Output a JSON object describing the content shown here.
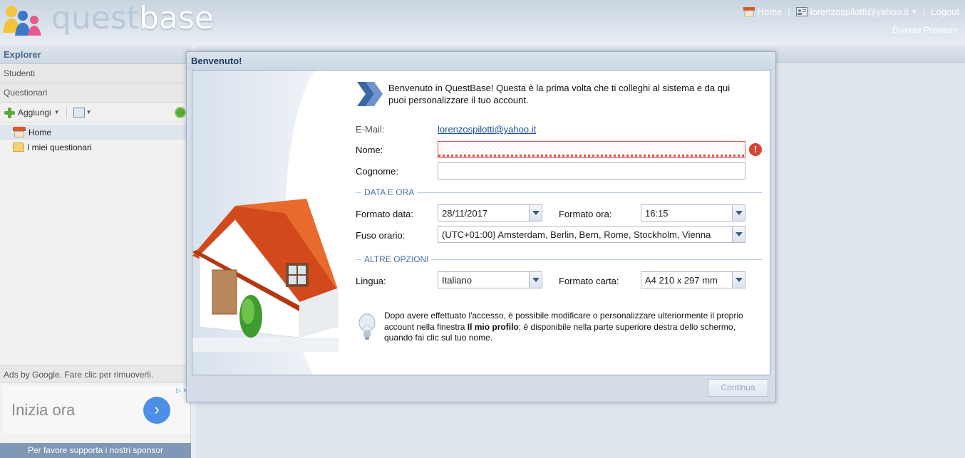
{
  "header": {
    "logo_text_left": "quest",
    "logo_text_right": "base",
    "home_label": "Home",
    "user_label": "lorenzospilotti@yahoo.it",
    "logout_label": "Logout",
    "premium_label": "Diventa Premium",
    "separator": "|"
  },
  "sidebar": {
    "title": "Explorer",
    "items": [
      {
        "label": "Studenti"
      },
      {
        "label": "Questionari"
      }
    ],
    "toolbar": {
      "add_label": "Aggiungi"
    },
    "tree": [
      {
        "label": "Home",
        "icon": "home-icon"
      },
      {
        "label": "I miei questionari",
        "icon": "folder-icon"
      }
    ],
    "ads_label": "Ads by Google. Fare clic per rimuoverli.",
    "ad": {
      "text": "Inizia ora",
      "button": "›"
    },
    "sponsor_label": "Per favore supporta i nostri sponsor"
  },
  "dialog": {
    "title": "Benvenuto!",
    "welcome_text": "Benvenuto in QuestBase! Questa è la prima volta che ti colleghi al sistema e da qui puoi personalizzare il tuo account.",
    "email_label": "E-Mail:",
    "email_value": "lorenzospilotti@yahoo.it",
    "nome_label": "Nome:",
    "nome_value": "",
    "cognome_label": "Cognome:",
    "cognome_value": "",
    "section_date": "DATA E ORA",
    "date_format_label": "Formato data:",
    "date_format_value": "28/11/2017",
    "time_format_label": "Formato ora:",
    "time_format_value": "16:15",
    "timezone_label": "Fuso orario:",
    "timezone_value": "(UTC+01:00) Amsterdam, Berlin, Bern, Rome, Stockholm, Vienna",
    "section_other": "ALTRE OPZIONI",
    "language_label": "Lingua:",
    "language_value": "Italiano",
    "paper_label": "Formato carta:",
    "paper_value": "A4 210 x 297 mm",
    "tip_part1": "Dopo avere effettuato l'accesso, è possibile modificare o personalizzare ulteriormente il proprio account nella finestra ",
    "tip_bold": "Il mio profilo",
    "tip_part2": "; è disponibile nella parte superiore destra dello schermo, quando fai clic sul tuo nome.",
    "continue_label": "Continua",
    "error_mark": "!"
  },
  "colors": {
    "accent": "#4a73a7",
    "error": "#d9432f",
    "link": "#1c4fa0"
  }
}
